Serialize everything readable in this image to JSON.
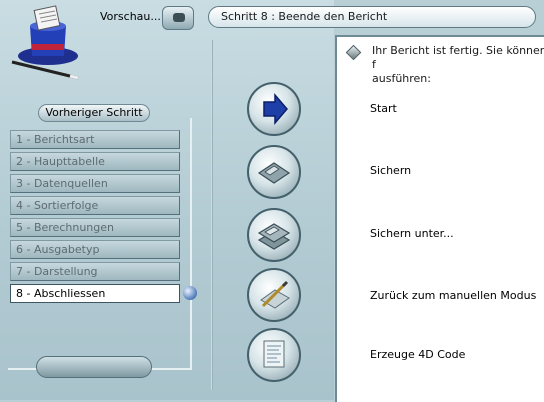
{
  "header": {
    "preview_label": "Vorschau...",
    "step_title": "Schritt 8 : Beende den Bericht"
  },
  "sidebar": {
    "previous_step_label": "Vorheriger Schritt",
    "steps": [
      {
        "label": "1 - Berichtsart",
        "active": false
      },
      {
        "label": "2 - Haupttabelle",
        "active": false
      },
      {
        "label": "3 - Datenquellen",
        "active": false
      },
      {
        "label": "4 - Sortierfolge",
        "active": false
      },
      {
        "label": "5 - Berechnungen",
        "active": false
      },
      {
        "label": "6 - Ausgabetyp",
        "active": false
      },
      {
        "label": "7 - Darstellung",
        "active": false
      },
      {
        "label": "8 - Abschliessen",
        "active": true
      }
    ]
  },
  "main": {
    "info_text": "Ihr Bericht ist fertig. Sie können f\nausführen:",
    "actions": [
      {
        "label": "Start",
        "icon": "arrow-right-icon"
      },
      {
        "label": "Sichern",
        "icon": "save-disk-icon"
      },
      {
        "label": "Sichern unter...",
        "icon": "save-as-disks-icon"
      },
      {
        "label": "Zurück zum manuellen Modus",
        "icon": "manual-mode-icon"
      },
      {
        "label": "Erzeuge 4D Code",
        "icon": "code-document-icon"
      }
    ]
  },
  "colors": {
    "background": "#b9cfd6",
    "accent_blue": "#1f3fa8",
    "active_step": "#ffffff"
  }
}
